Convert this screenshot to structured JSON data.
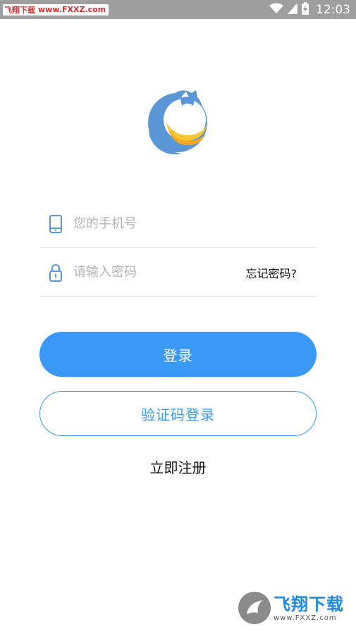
{
  "status_bar": {
    "watermark_label": "飞翔下载",
    "watermark_site": "www.FXXZ.com",
    "time": "12:03"
  },
  "login": {
    "phone_placeholder": "您的手机号",
    "password_placeholder": "请输入密码",
    "forgot_label": "忘记密码?",
    "login_label": "登录",
    "code_login_label": "验证码登录",
    "register_label": "立即注册"
  },
  "watermark_bottom": {
    "brand": "飞翔下载",
    "url": "www.FXXZ.com"
  },
  "colors": {
    "accent": "#3a98f6",
    "status_bar": "#9e9e9e",
    "logo_blue": "#5b97d6",
    "logo_yellow": "#f7c531"
  },
  "icons": {
    "phone": "phone-icon",
    "lock": "lock-icon",
    "wifi": "wifi-icon",
    "signal": "signal-icon",
    "battery": "battery-charging-icon"
  }
}
